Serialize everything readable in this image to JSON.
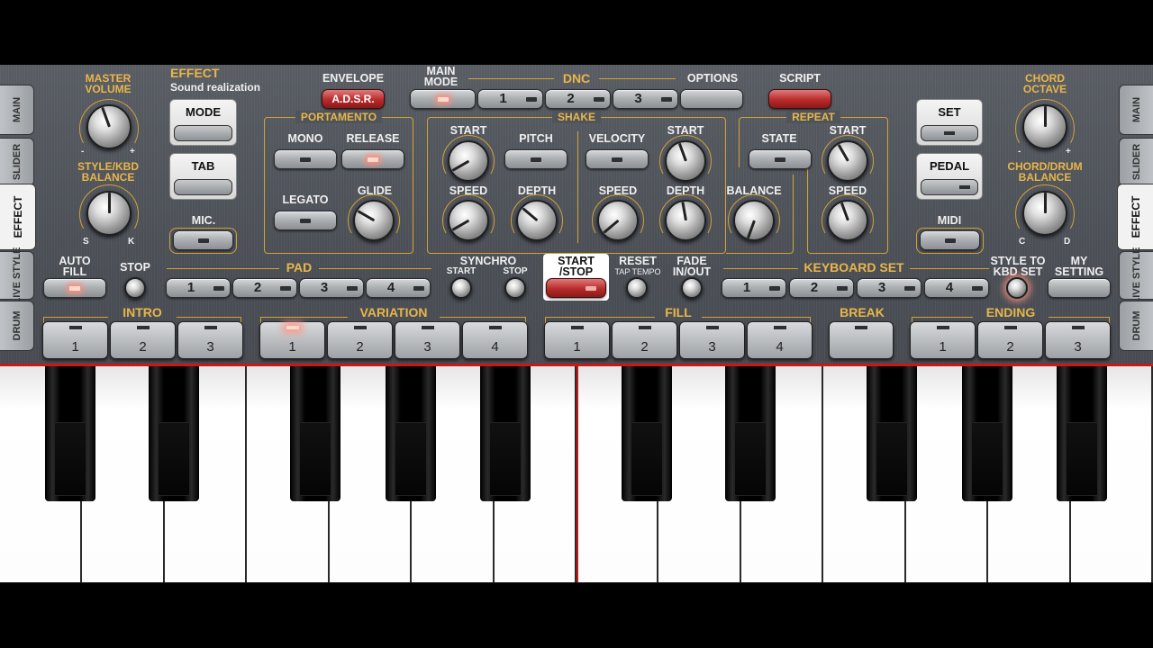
{
  "side_tabs_left": [
    "MAIN",
    "SLIDER",
    "EFFECT",
    "LIVE STYLE",
    "DRUM"
  ],
  "side_tabs_right": [
    "MAIN",
    "SLIDER",
    "EFFECT",
    "LIVE STYLE",
    "DRUM"
  ],
  "active_tab": "EFFECT",
  "left_controls": {
    "master_volume": "MASTER\nVOLUME",
    "minus": "-",
    "plus": "+",
    "style_kbd_balance": "STYLE/KBD\nBALANCE",
    "s": "S",
    "k": "K"
  },
  "effect": {
    "title": "EFFECT",
    "subtitle": "Sound realization",
    "mode": "MODE",
    "tab": "TAB",
    "mic": "MIC."
  },
  "header": {
    "envelope": "ENVELOPE",
    "adsr": "A.D.S.R.",
    "main_mode": "MAIN\nMODE",
    "dnc": "DNC",
    "options": "OPTIONS",
    "script": "SCRIPT",
    "dnc_buttons": [
      "1",
      "2",
      "3"
    ]
  },
  "portamento": {
    "title": "PORTAMENTO",
    "mono": "MONO",
    "release": "RELEASE",
    "legato": "LEGATO",
    "glide": "GLIDE"
  },
  "shake": {
    "title": "SHAKE",
    "start": "START",
    "pitch": "PITCH",
    "velocity": "VELOCITY",
    "start2": "START",
    "speed": "SPEED",
    "depth": "DEPTH",
    "speed2": "SPEED",
    "depth2": "DEPTH",
    "balance": "BALANCE"
  },
  "repeat": {
    "title": "REPEAT",
    "state": "STATE",
    "start": "START",
    "speed": "SPEED"
  },
  "right_controls": {
    "set": "SET",
    "pedal": "PEDAL",
    "midi": "MIDI",
    "chord_octave": "CHORD\nOCTAVE",
    "chord_drum_balance": "CHORD/DRUM\nBALANCE",
    "minus": "-",
    "plus": "+",
    "c": "C",
    "d": "D"
  },
  "row2": {
    "auto_fill": "AUTO\nFILL",
    "stop": "STOP",
    "pad": "PAD",
    "pad_buttons": [
      "1",
      "2",
      "3",
      "4"
    ],
    "synchro": "SYNCHRO",
    "synchro_start": "START",
    "synchro_stop": "STOP",
    "start_stop": "START\n/STOP",
    "reset": "RESET",
    "tap_tempo": "TAP TEMPO",
    "fade": "FADE\nIN/OUT",
    "keyboard_set": "KEYBOARD SET",
    "kbd_buttons": [
      "1",
      "2",
      "3",
      "4"
    ],
    "style_to_kbd": "STYLE TO\nKBD SET",
    "my_setting": "MY\nSETTING"
  },
  "sections": {
    "intro": {
      "title": "INTRO",
      "buttons": [
        "1",
        "2",
        "3"
      ]
    },
    "variation": {
      "title": "VARIATION",
      "buttons": [
        "1",
        "2",
        "3",
        "4"
      ]
    },
    "fill": {
      "title": "FILL",
      "buttons": [
        "1",
        "2",
        "3",
        "4"
      ]
    },
    "break": {
      "title": "BREAK"
    },
    "ending": {
      "title": "ENDING",
      "buttons": [
        "1",
        "2",
        "3"
      ]
    }
  }
}
